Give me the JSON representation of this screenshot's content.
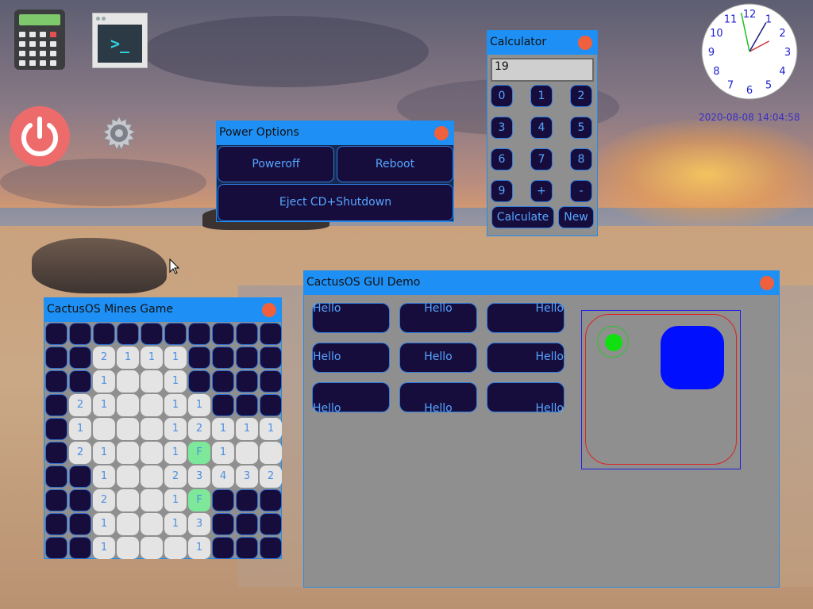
{
  "desktop": {
    "icons": [
      {
        "name": "calculator-icon"
      },
      {
        "name": "terminal-icon",
        "glyph": ">_"
      },
      {
        "name": "power-icon"
      },
      {
        "name": "settings-icon"
      }
    ],
    "clock": {
      "numbers": [
        "12",
        "1",
        "2",
        "3",
        "4",
        "5",
        "6",
        "7",
        "8",
        "9",
        "10",
        "11"
      ],
      "time": "14:04:58",
      "datetime": "2020-08-08 14:04:58"
    }
  },
  "power_window": {
    "title": "Power Options",
    "buttons": {
      "poweroff": "Poweroff",
      "reboot": "Reboot",
      "eject": "Eject CD+Shutdown"
    }
  },
  "calculator_window": {
    "title": "Calculator",
    "display": "19",
    "keys": [
      "0",
      "1",
      "2",
      "3",
      "4",
      "5",
      "6",
      "7",
      "8",
      "9",
      "+",
      "-"
    ],
    "calculate_label": "Calculate",
    "new_label": "New"
  },
  "mines_window": {
    "title": "CactusOS Mines Game",
    "grid": [
      "##########",
      "##2111####",
      "##1__1####",
      "#21__11###",
      "#1___12111",
      "#21__1F1__",
      "##1__23432",
      "##2__1F###",
      "##1__13###",
      "##1___1###"
    ],
    "flag_label": "F"
  },
  "demo_window": {
    "title": "CactusOS GUI Demo",
    "hello_label": "Hello"
  },
  "colors": {
    "titlebar": "#1e90f5",
    "button_bg": "#170d3d",
    "button_text": "#55a6ff",
    "close": "#f0603c",
    "flag": "#7de89a"
  }
}
